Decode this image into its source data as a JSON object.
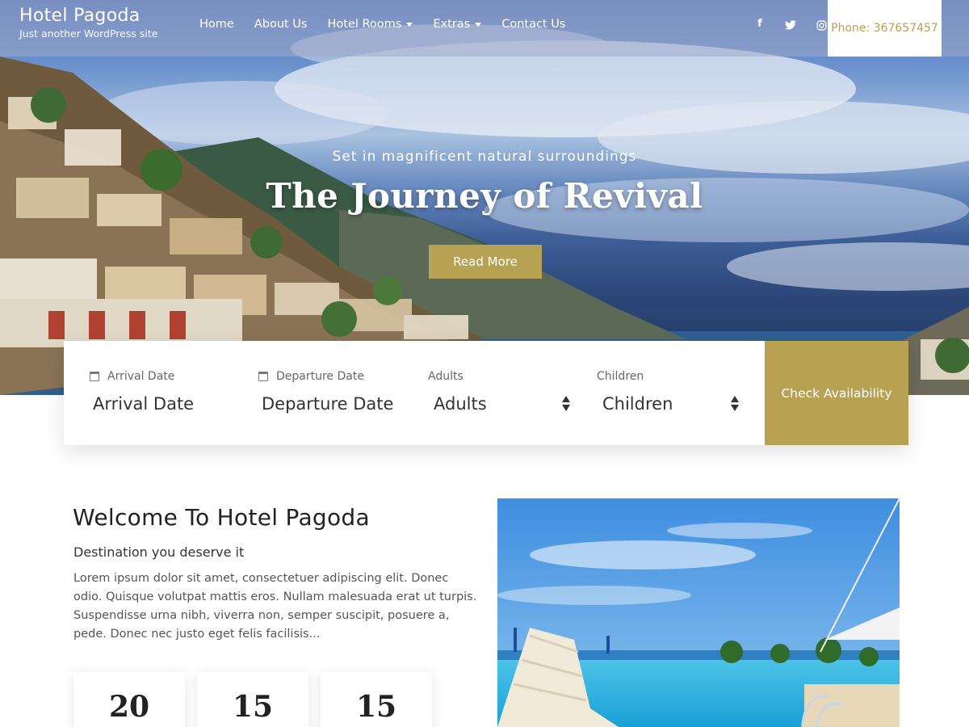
{
  "brand": {
    "title": "Hotel Pagoda",
    "tagline": "Just another WordPress site"
  },
  "nav": {
    "items": [
      {
        "label": "Home",
        "dropdown": false
      },
      {
        "label": "About Us",
        "dropdown": false
      },
      {
        "label": "Hotel Rooms",
        "dropdown": true
      },
      {
        "label": "Extras",
        "dropdown": true
      },
      {
        "label": "Contact Us",
        "dropdown": false
      }
    ],
    "socials": [
      {
        "icon": "facebook-icon",
        "glyph": "f"
      },
      {
        "icon": "twitter-icon",
        "glyph": "t"
      },
      {
        "icon": "instagram-icon",
        "glyph": "◎"
      }
    ],
    "phone": "Phone: 367657457"
  },
  "hero": {
    "subtitle": "Set in magnificent natural surroundings",
    "title": "The Journey of Revival",
    "button": "Read More"
  },
  "booking": {
    "arrival": {
      "label": "Arrival Date",
      "placeholder": "Arrival Date"
    },
    "departure": {
      "label": "Departure Date",
      "placeholder": "Departure Date"
    },
    "adults": {
      "label": "Adults",
      "value": "Adults"
    },
    "children": {
      "label": "Children",
      "value": "Children"
    },
    "button": "Check Availability"
  },
  "welcome": {
    "title": "Welcome To Hotel Pagoda",
    "subtitle": "Destination you deserve it",
    "body": "Lorem ipsum dolor sit amet, consectetuer adipiscing elit. Donec odio. Quisque volutpat mattis eros. Nullam malesuada erat ut turpis. Suspendisse urna nibh, viverra non, semper suscipit, posuere a, pede. Donec nec justo eget felis facilisis...",
    "stats": [
      "20",
      "15",
      "15"
    ]
  },
  "colors": {
    "accent": "#b7a253",
    "phone_text": "#b8a154"
  }
}
